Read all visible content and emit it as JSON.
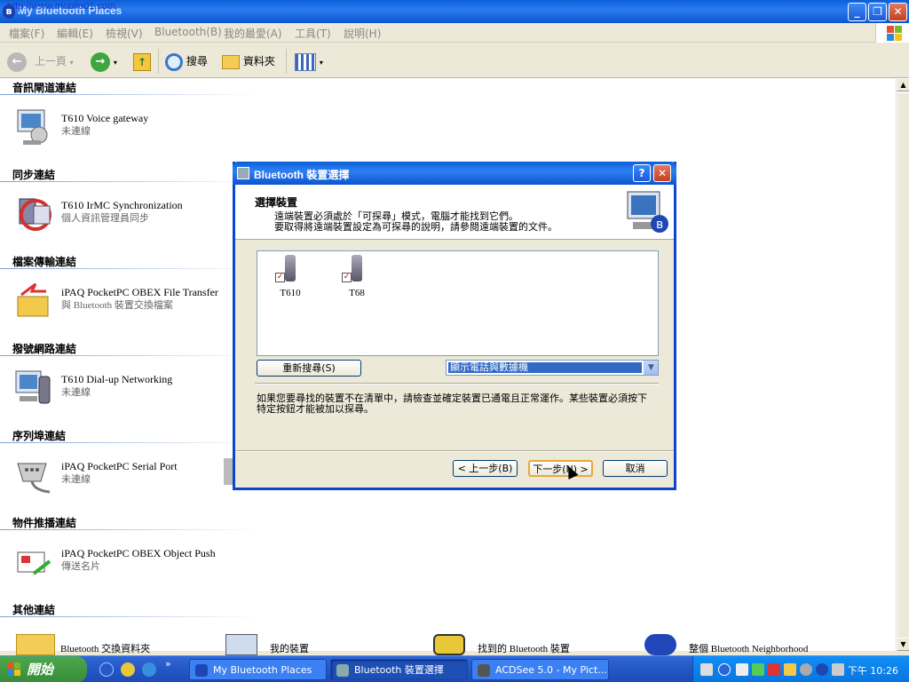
{
  "window": {
    "title": "My Bluetooth Places",
    "watermark_url": "http://www.mobile01.com"
  },
  "menu": [
    "檔案(F)",
    "編輯(E)",
    "檢視(V)",
    "Bluetooth(B)",
    "我的最愛(A)",
    "工具(T)",
    "說明(H)"
  ],
  "toolbar": {
    "back_label": "上一頁",
    "search_label": "搜尋",
    "folders_label": "資料夾"
  },
  "groups": [
    {
      "title": "音訊閘道連結",
      "name": "T610 Voice gateway",
      "sub": "未連線"
    },
    {
      "title": "同步連結",
      "name": "T610 IrMC Synchronization",
      "sub": "個人資訊管理員同步"
    },
    {
      "title": "檔案傳輸連結",
      "name": "iPAQ PocketPC OBEX File Transfer",
      "sub": "與 Bluetooth 裝置交換檔案"
    },
    {
      "title": "撥號網路連結",
      "name": "T610 Dial-up Networking",
      "sub": "未連線"
    },
    {
      "title": "序列埠連結",
      "name": "iPAQ PocketPC Serial Port",
      "sub": "未連線"
    },
    {
      "title": "物件推播連結",
      "name": "iPAQ PocketPC OBEX Object Push",
      "sub": "傳送名片"
    },
    {
      "title": "其他連結",
      "name": "",
      "sub": ""
    }
  ],
  "other_items": [
    "Bluetooth 交換資料夾",
    "我的裝置",
    "找到的 Bluetooth 裝置",
    "整個 Bluetooth Neighborhood"
  ],
  "dialog": {
    "title": "Bluetooth 裝置選擇",
    "heading": "選擇裝置",
    "desc1": "遠端裝置必須處於「可探尋」模式，電腦才能找到它們。",
    "desc2": "要取得將遠端裝置設定為可探尋的說明，請參閱遠端裝置的文件。",
    "devices": [
      "T610",
      "T68"
    ],
    "research_button": "重新搜尋(S)",
    "filter_value": "顯示電話與數據機",
    "message": "如果您要尋找的裝置不在清單中，請檢查並確定裝置已通電且正常運作。某些裝置必須按下特定按鈕才能被加以探尋。",
    "back_button": "< 上一步(B)",
    "next_button": "下一步(N) >",
    "cancel_button": "取消"
  },
  "taskbar": {
    "start_label": "開始",
    "tasks": [
      "My Bluetooth Places",
      "Bluetooth 裝置選擇",
      "ACDSee 5.0 - My Pict..."
    ],
    "clock": "下午 10:26"
  }
}
